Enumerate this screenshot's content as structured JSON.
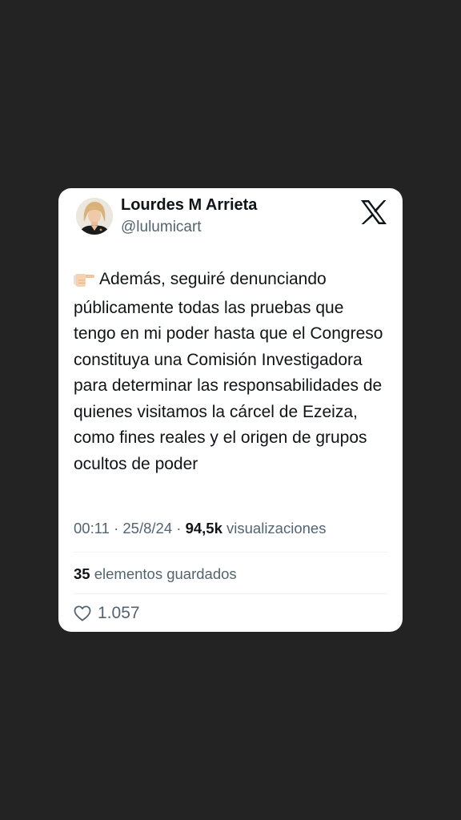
{
  "author": {
    "name": "Lourdes M Arrieta",
    "handle": "@lulumicart"
  },
  "brand": {
    "icon": "x-logo-icon"
  },
  "tweet": {
    "emoji": "backhand-index-pointing-right",
    "text": "Además, seguiré denunciando públicamente todas las pruebas que tengo en mi poder hasta que el Congreso constituya una Comisión Investigadora para determinar las responsabilidades de quienes visitamos la cárcel de Ezeiza, como fines reales y el origen de grupos ocultos de poder"
  },
  "meta": {
    "time": "00:11",
    "separator": "·",
    "date": "25/8/24",
    "views_count": "94,5k",
    "views_label": "visualizaciones"
  },
  "bookmarks": {
    "count": "35",
    "label": "elementos guardados"
  },
  "likes": {
    "count": "1.057",
    "icon": "heart-icon"
  },
  "colors": {
    "background": "#232323",
    "card": "#ffffff",
    "text_primary": "#0f1419",
    "text_secondary": "#536471"
  }
}
